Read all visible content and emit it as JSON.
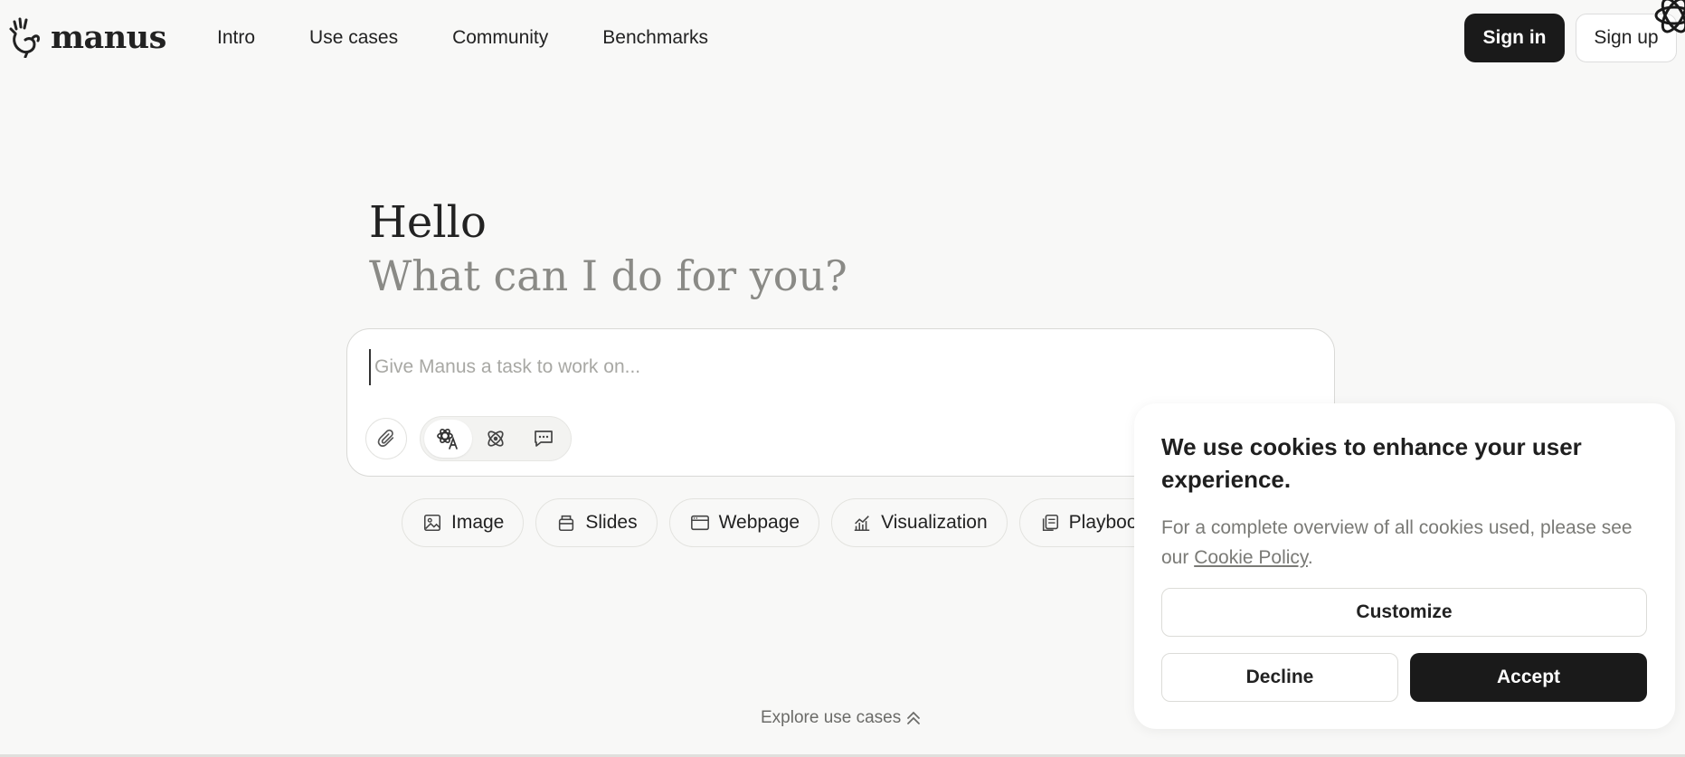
{
  "brand": {
    "name": "manus"
  },
  "nav": {
    "items": [
      {
        "label": "Intro"
      },
      {
        "label": "Use cases"
      },
      {
        "label": "Community"
      },
      {
        "label": "Benchmarks"
      }
    ]
  },
  "auth": {
    "signin_label": "Sign in",
    "signup_label": "Sign up"
  },
  "hero": {
    "greeting": "Hello",
    "prompt": "What can I do for you?"
  },
  "task": {
    "placeholder": "Give Manus a task to work on...",
    "value": "",
    "icons": [
      "paperclip-icon",
      "agent-translate-icon",
      "atom-icon",
      "chat-icon"
    ]
  },
  "chips": [
    {
      "label": "Image",
      "icon": "image-icon"
    },
    {
      "label": "Slides",
      "icon": "slides-icon"
    },
    {
      "label": "Webpage",
      "icon": "webpage-icon"
    },
    {
      "label": "Visualization",
      "icon": "chart-icon"
    },
    {
      "label": "Playbook",
      "icon": "playbook-icon"
    }
  ],
  "explore": {
    "label": "Explore use cases"
  },
  "cookie": {
    "title": "We use cookies to enhance your user experience.",
    "text_before": "For a complete overview of all cookies used, please see our ",
    "link_label": "Cookie Policy",
    "text_after": ".",
    "customize_label": "Customize",
    "decline_label": "Decline",
    "accept_label": "Accept"
  },
  "colors": {
    "background": "#f8f8f7",
    "primary_dark": "#1a1a1a",
    "muted_text": "#8a8a86"
  }
}
